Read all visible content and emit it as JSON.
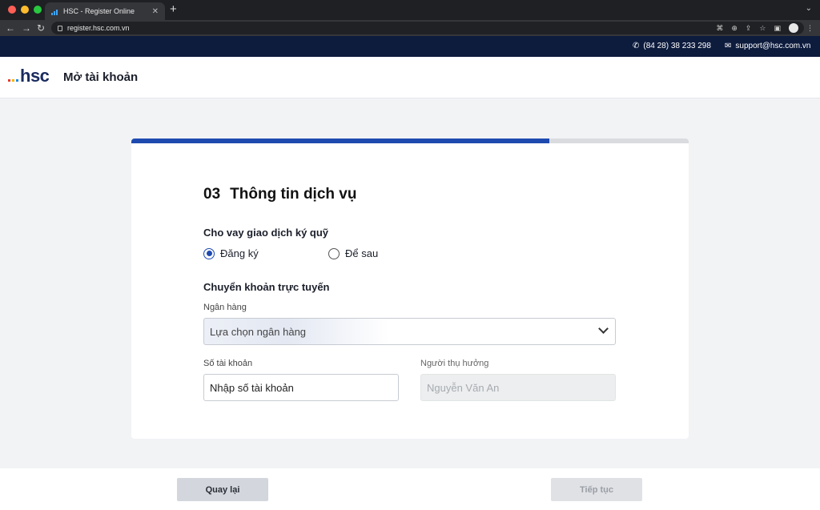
{
  "browser": {
    "tab_title": "HSC - Register Online",
    "new_tab_icon": "+",
    "url": "register.hsc.com.vn",
    "traffic_lights": [
      "#ff5f57",
      "#febc2e",
      "#28c840"
    ]
  },
  "contact": {
    "phone": "(84 28) 38 233 298",
    "email": "support@hsc.com.vn"
  },
  "header": {
    "logo_text": "hsc",
    "logo_dot_colors": [
      "#e63b2e",
      "#f4b400",
      "#1e88e5"
    ],
    "title": "Mở tài khoản"
  },
  "form": {
    "progress_percent": 75,
    "step_number": "03",
    "step_title": "Thông tin dịch vụ",
    "margin_section": {
      "label": "Cho vay giao dịch ký quỹ",
      "options": [
        {
          "label": "Đăng ký",
          "selected": true
        },
        {
          "label": "Để sau",
          "selected": false
        }
      ]
    },
    "transfer_section": {
      "label": "Chuyển khoản trực tuyến",
      "bank": {
        "label": "Ngân hàng",
        "placeholder": "Lựa chọn ngân hàng"
      },
      "account_number": {
        "label": "Số tài khoản",
        "placeholder": "Nhập số tài khoản"
      },
      "beneficiary": {
        "label": "Người thụ hưởng",
        "placeholder": "Nguyễn Văn An"
      }
    }
  },
  "footer": {
    "back_label": "Quay lại",
    "next_label": "Tiếp tục"
  },
  "colors": {
    "brand_navy": "#0d1b3d",
    "accent_blue": "#1e4ab0"
  }
}
